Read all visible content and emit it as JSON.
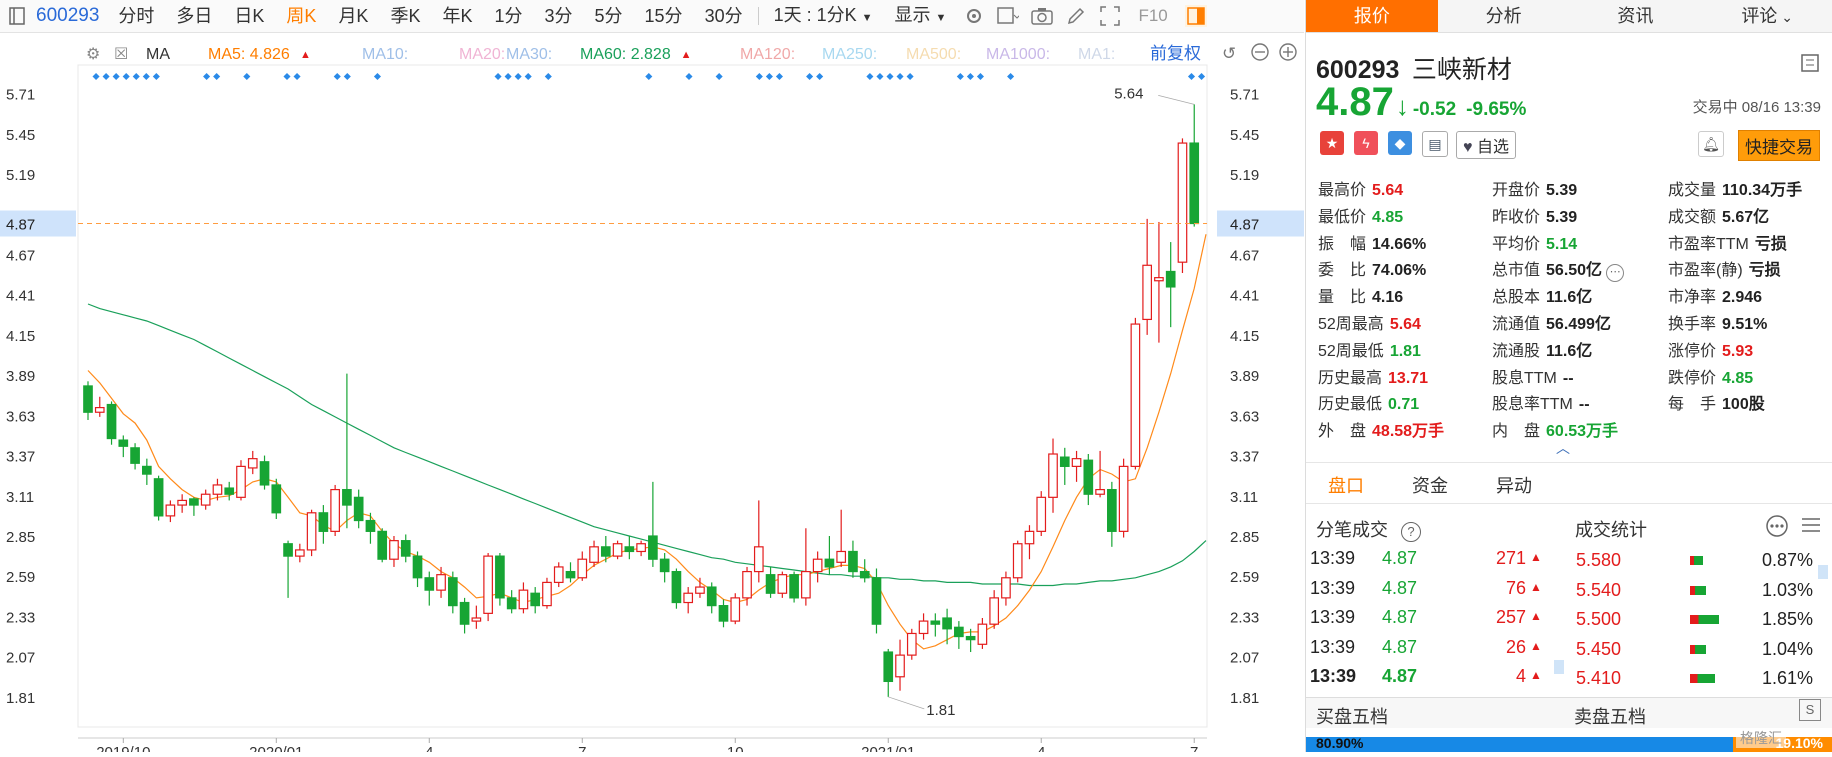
{
  "toolbar": {
    "code": "600293",
    "periods": [
      "分时",
      "多日",
      "日K",
      "周K",
      "月K",
      "季K",
      "年K",
      "1分",
      "3分",
      "5分",
      "15分",
      "30分"
    ],
    "active_period": "周K",
    "interval_select": "1天 : 1分K",
    "display_label": "显示",
    "f10_label": "F10"
  },
  "ma_bar": {
    "ma_label": "MA",
    "items": [
      {
        "text": "MA5: 4.826",
        "color": "#ff7e00",
        "arrow": "up"
      },
      {
        "text": "MA10:",
        "color": "#9fbfe8",
        "arrow": ""
      },
      {
        "text": "MA20:",
        "color": "#f0b4d4",
        "arrow": ""
      },
      {
        "text": "MA30:",
        "color": "#9fbfe8",
        "arrow": ""
      },
      {
        "text": "MA60: 2.828",
        "color": "#1aa05a",
        "arrow": "up"
      },
      {
        "text": "MA120:",
        "color": "#f0a8a8",
        "arrow": ""
      },
      {
        "text": "MA250:",
        "color": "#a8d8f0",
        "arrow": ""
      },
      {
        "text": "MA500:",
        "color": "#f5dcb0",
        "arrow": ""
      },
      {
        "text": "MA1000:",
        "color": "#c9b8e8",
        "arrow": ""
      },
      {
        "text": "MA1:",
        "color": "#cfd8e8",
        "arrow": ""
      }
    ],
    "adjust_label": "前复权"
  },
  "chart_data": {
    "type": "candlestick",
    "y_ticks": [
      "5.71",
      "5.45",
      "5.19",
      "4.67",
      "4.41",
      "4.15",
      "3.89",
      "3.63",
      "3.37",
      "3.11",
      "2.85",
      "2.59",
      "2.33",
      "2.07",
      "1.81"
    ],
    "x_ticks": [
      "2019/10",
      "2020/01",
      "4",
      "7",
      "10",
      "2021/01",
      "4",
      "7"
    ],
    "ylim": [
      1.68,
      5.83
    ],
    "current_price": "4.87",
    "max_label": "5.64",
    "min_label": "1.81",
    "candles": [
      [
        3.82,
        3.65,
        3.85,
        3.6
      ],
      [
        3.65,
        3.68,
        3.75,
        3.62
      ],
      [
        3.7,
        3.48,
        3.72,
        3.44
      ],
      [
        3.47,
        3.43,
        3.5,
        3.36
      ],
      [
        3.42,
        3.32,
        3.45,
        3.28
      ],
      [
        3.3,
        3.25,
        3.35,
        3.18
      ],
      [
        3.22,
        2.98,
        3.24,
        2.95
      ],
      [
        2.98,
        3.05,
        3.08,
        2.94
      ],
      [
        3.05,
        3.08,
        3.12,
        3.0
      ],
      [
        3.09,
        3.05,
        3.1,
        2.98
      ],
      [
        3.05,
        3.12,
        3.15,
        3.02
      ],
      [
        3.12,
        3.18,
        3.22,
        3.08
      ],
      [
        3.16,
        3.12,
        3.2,
        3.08
      ],
      [
        3.1,
        3.3,
        3.34,
        3.08
      ],
      [
        3.29,
        3.35,
        3.4,
        3.25
      ],
      [
        3.33,
        3.18,
        3.37,
        3.15
      ],
      [
        3.18,
        3.0,
        3.22,
        2.96
      ],
      [
        2.8,
        2.72,
        2.82,
        2.45
      ],
      [
        2.72,
        2.76,
        2.8,
        2.68
      ],
      [
        2.76,
        3.0,
        3.02,
        2.72
      ],
      [
        3.0,
        2.88,
        3.05,
        2.8
      ],
      [
        2.88,
        3.15,
        3.18,
        2.85
      ],
      [
        3.15,
        3.05,
        3.9,
        2.9
      ],
      [
        3.1,
        2.95,
        3.15,
        2.9
      ],
      [
        2.95,
        2.88,
        3.0,
        2.8
      ],
      [
        2.88,
        2.7,
        2.9,
        2.68
      ],
      [
        2.7,
        2.82,
        2.85,
        2.65
      ],
      [
        2.82,
        2.72,
        2.86,
        2.68
      ],
      [
        2.72,
        2.58,
        2.75,
        2.52
      ],
      [
        2.58,
        2.5,
        2.62,
        2.4
      ],
      [
        2.5,
        2.6,
        2.65,
        2.45
      ],
      [
        2.58,
        2.4,
        2.62,
        2.35
      ],
      [
        2.42,
        2.28,
        2.45,
        2.22
      ],
      [
        2.3,
        2.32,
        2.4,
        2.25
      ],
      [
        2.35,
        2.72,
        2.74,
        2.3
      ],
      [
        2.72,
        2.45,
        2.74,
        2.4
      ],
      [
        2.45,
        2.38,
        2.5,
        2.35
      ],
      [
        2.38,
        2.5,
        2.55,
        2.35
      ],
      [
        2.48,
        2.4,
        2.52,
        2.35
      ],
      [
        2.4,
        2.55,
        2.58,
        2.38
      ],
      [
        2.55,
        2.65,
        2.68,
        2.52
      ],
      [
        2.62,
        2.58,
        2.68,
        2.55
      ],
      [
        2.58,
        2.7,
        2.75,
        2.56
      ],
      [
        2.68,
        2.78,
        2.82,
        2.65
      ],
      [
        2.78,
        2.72,
        2.85,
        2.68
      ],
      [
        2.72,
        2.8,
        2.82,
        2.7
      ],
      [
        2.78,
        2.75,
        2.85,
        2.7
      ],
      [
        2.75,
        2.8,
        2.82,
        2.72
      ],
      [
        2.85,
        2.7,
        3.2,
        2.65
      ],
      [
        2.7,
        2.62,
        2.74,
        2.55
      ],
      [
        2.62,
        2.42,
        2.64,
        2.38
      ],
      [
        2.42,
        2.48,
        2.52,
        2.35
      ],
      [
        2.48,
        2.52,
        2.58,
        2.45
      ],
      [
        2.52,
        2.4,
        2.55,
        2.35
      ],
      [
        2.4,
        2.3,
        2.44,
        2.26
      ],
      [
        2.3,
        2.45,
        2.48,
        2.28
      ],
      [
        2.45,
        2.62,
        2.65,
        2.4
      ],
      [
        2.62,
        2.78,
        3.08,
        2.55
      ],
      [
        2.6,
        2.48,
        2.65,
        2.45
      ],
      [
        2.48,
        2.6,
        2.62,
        2.45
      ],
      [
        2.6,
        2.45,
        2.62,
        2.42
      ],
      [
        2.45,
        2.62,
        2.9,
        2.4
      ],
      [
        2.62,
        2.7,
        2.75,
        2.55
      ],
      [
        2.7,
        2.65,
        2.85,
        2.6
      ],
      [
        2.68,
        2.75,
        3.02,
        2.65
      ],
      [
        2.75,
        2.62,
        2.82,
        2.58
      ],
      [
        2.62,
        2.58,
        2.7,
        2.55
      ],
      [
        2.58,
        2.28,
        2.64,
        2.22
      ],
      [
        2.1,
        1.91,
        2.12,
        1.81
      ],
      [
        1.94,
        2.08,
        2.18,
        1.85
      ],
      [
        2.08,
        2.22,
        2.25,
        2.05
      ],
      [
        2.22,
        2.3,
        2.35,
        2.18
      ],
      [
        2.3,
        2.28,
        2.35,
        2.2
      ],
      [
        2.32,
        2.25,
        2.38,
        2.15
      ],
      [
        2.26,
        2.2,
        2.3,
        2.12
      ],
      [
        2.2,
        2.18,
        2.25,
        2.1
      ],
      [
        2.15,
        2.28,
        2.32,
        2.12
      ],
      [
        2.28,
        2.45,
        2.5,
        2.25
      ],
      [
        2.45,
        2.58,
        2.62,
        2.4
      ],
      [
        2.58,
        2.8,
        2.82,
        2.55
      ],
      [
        2.8,
        2.88,
        2.92,
        2.7
      ],
      [
        2.88,
        3.1,
        3.14,
        2.85
      ],
      [
        3.1,
        3.38,
        3.48,
        3.0
      ],
      [
        3.36,
        3.3,
        3.42,
        3.18
      ],
      [
        3.3,
        3.35,
        3.4,
        3.2
      ],
      [
        3.34,
        3.12,
        3.38,
        3.05
      ],
      [
        3.12,
        3.15,
        3.4,
        3.1
      ],
      [
        3.15,
        2.88,
        3.2,
        2.78
      ],
      [
        2.88,
        3.3,
        3.35,
        2.84
      ],
      [
        3.3,
        4.22,
        4.26,
        3.28
      ],
      [
        4.25,
        4.6,
        4.9,
        4.15
      ],
      [
        4.5,
        4.52,
        4.88,
        4.1
      ],
      [
        4.56,
        4.46,
        4.75,
        4.2
      ],
      [
        4.62,
        5.39,
        5.42,
        4.55
      ],
      [
        5.39,
        4.87,
        5.64,
        4.85
      ]
    ],
    "ma5": [
      3.92,
      3.84,
      3.74,
      3.64,
      3.58,
      3.47,
      3.3,
      3.22,
      3.15,
      3.1,
      3.08,
      3.1,
      3.11,
      3.15,
      3.2,
      3.22,
      3.2,
      3.1,
      3.0,
      2.98,
      2.92,
      2.88,
      2.95,
      3.0,
      2.98,
      2.88,
      2.8,
      2.75,
      2.72,
      2.68,
      2.62,
      2.58,
      2.52,
      2.45,
      2.46,
      2.48,
      2.45,
      2.42,
      2.44,
      2.46,
      2.48,
      2.53,
      2.6,
      2.66,
      2.7,
      2.74,
      2.76,
      2.77,
      2.78,
      2.76,
      2.7,
      2.62,
      2.55,
      2.5,
      2.44,
      2.42,
      2.44,
      2.5,
      2.55,
      2.58,
      2.6,
      2.6,
      2.62,
      2.64,
      2.66,
      2.66,
      2.64,
      2.55,
      2.4,
      2.28,
      2.18,
      2.12,
      2.14,
      2.18,
      2.22,
      2.23,
      2.23,
      2.27,
      2.32,
      2.4,
      2.5,
      2.62,
      2.78,
      2.95,
      3.1,
      3.22,
      3.28,
      3.25,
      3.2,
      3.22,
      3.42,
      3.65,
      3.9,
      4.18,
      4.45,
      4.8
    ],
    "ma60": [
      4.35,
      4.32,
      4.3,
      4.28,
      4.26,
      4.24,
      4.21,
      4.18,
      4.15,
      4.12,
      4.08,
      4.04,
      4.0,
      3.96,
      3.92,
      3.88,
      3.84,
      3.8,
      3.75,
      3.7,
      3.66,
      3.62,
      3.58,
      3.54,
      3.5,
      3.46,
      3.42,
      3.39,
      3.36,
      3.33,
      3.3,
      3.27,
      3.24,
      3.21,
      3.18,
      3.15,
      3.12,
      3.09,
      3.06,
      3.03,
      3.0,
      2.97,
      2.94,
      2.91,
      2.89,
      2.87,
      2.85,
      2.83,
      2.81,
      2.79,
      2.77,
      2.75,
      2.73,
      2.71,
      2.7,
      2.68,
      2.67,
      2.66,
      2.65,
      2.64,
      2.63,
      2.62,
      2.61,
      2.6,
      2.6,
      2.59,
      2.59,
      2.58,
      2.58,
      2.57,
      2.57,
      2.56,
      2.56,
      2.55,
      2.55,
      2.55,
      2.54,
      2.54,
      2.54,
      2.54,
      2.53,
      2.53,
      2.53,
      2.54,
      2.54,
      2.55,
      2.56,
      2.56,
      2.57,
      2.58,
      2.6,
      2.62,
      2.65,
      2.69,
      2.75,
      2.82
    ]
  },
  "signal_dots": [
    1,
    2,
    3,
    4,
    5,
    6,
    7,
    12,
    13,
    16,
    20,
    21,
    25,
    26,
    29,
    41,
    42,
    43,
    44,
    46,
    56,
    60,
    63,
    67,
    68,
    69,
    72,
    73,
    78,
    79,
    80,
    81,
    82,
    87,
    88,
    89,
    92,
    110,
    111,
    113,
    114,
    115
  ],
  "quote": {
    "code": "600293",
    "name": "三峡新材",
    "price": "4.87",
    "change": "-0.52",
    "change_pct": "-9.65%",
    "status": "交易中 08/16 13:39",
    "watch_label": "自选",
    "trade_label": "快捷交易",
    "fields": [
      {
        "label": "最高价",
        "value": "5.64",
        "color": "red",
        "col": 0,
        "row": 0
      },
      {
        "label": "最低价",
        "value": "4.85",
        "color": "green",
        "col": 0,
        "row": 1
      },
      {
        "label": "振　幅",
        "value": "14.66%",
        "color": "black",
        "col": 0,
        "row": 2
      },
      {
        "label": "委　比",
        "value": "74.06%",
        "color": "black",
        "col": 0,
        "row": 3
      },
      {
        "label": "量　比",
        "value": "4.16",
        "color": "black",
        "col": 0,
        "row": 4
      },
      {
        "label": "52周最高",
        "value": "5.64",
        "color": "red",
        "col": 0,
        "row": 5
      },
      {
        "label": "52周最低",
        "value": "1.81",
        "color": "green",
        "col": 0,
        "row": 6
      },
      {
        "label": "历史最高",
        "value": "13.71",
        "color": "red",
        "col": 0,
        "row": 7
      },
      {
        "label": "历史最低",
        "value": "0.71",
        "color": "green",
        "col": 0,
        "row": 8
      },
      {
        "label": "外　盘",
        "value": "48.58万手",
        "color": "red",
        "col": 0,
        "row": 9
      },
      {
        "label": "开盘价",
        "value": "5.39",
        "color": "black",
        "col": 1,
        "row": 0
      },
      {
        "label": "昨收价",
        "value": "5.39",
        "color": "black",
        "col": 1,
        "row": 1
      },
      {
        "label": "平均价",
        "value": "5.14",
        "color": "green",
        "col": 1,
        "row": 2
      },
      {
        "label": "总市值",
        "value": "56.50亿",
        "color": "black",
        "col": 1,
        "row": 3
      },
      {
        "label": "总股本",
        "value": "11.6亿",
        "color": "black",
        "col": 1,
        "row": 4
      },
      {
        "label": "流通值",
        "value": "56.499亿",
        "color": "black",
        "col": 1,
        "row": 5
      },
      {
        "label": "流通股",
        "value": "11.6亿",
        "color": "black",
        "col": 1,
        "row": 6
      },
      {
        "label": "股息TTM",
        "value": "--",
        "color": "black",
        "col": 1,
        "row": 7
      },
      {
        "label": "股息率TTM",
        "value": "--",
        "color": "black",
        "col": 1,
        "row": 8
      },
      {
        "label": "内　盘",
        "value": "60.53万手",
        "color": "green",
        "col": 1,
        "row": 9
      },
      {
        "label": "成交量",
        "value": "110.34万手",
        "color": "black",
        "col": 2,
        "row": 0
      },
      {
        "label": "成交额",
        "value": "5.67亿",
        "color": "black",
        "col": 2,
        "row": 1
      },
      {
        "label": "市盈率TTM",
        "value": "亏损",
        "color": "black",
        "col": 2,
        "row": 2
      },
      {
        "label": "市盈率(静)",
        "value": "亏损",
        "color": "black",
        "col": 2,
        "row": 3
      },
      {
        "label": "市净率",
        "value": "2.946",
        "color": "black",
        "col": 2,
        "row": 4
      },
      {
        "label": "换手率",
        "value": "9.51%",
        "color": "black",
        "col": 2,
        "row": 5
      },
      {
        "label": "涨停价",
        "value": "5.93",
        "color": "red",
        "col": 2,
        "row": 6
      },
      {
        "label": "跌停价",
        "value": "4.85",
        "color": "green",
        "col": 2,
        "row": 7
      },
      {
        "label": "每　手",
        "value": "100股",
        "color": "black",
        "col": 2,
        "row": 8
      }
    ]
  },
  "panel_tabs": [
    "报价",
    "分析",
    "资讯",
    "评论"
  ],
  "sub_tabs": [
    "盘口",
    "资金",
    "异动"
  ],
  "ticks_title": "分笔成交",
  "stats_title": "成交统计",
  "ticks": [
    {
      "time": "13:39",
      "price": "4.87",
      "vol": "271"
    },
    {
      "time": "13:39",
      "price": "4.87",
      "vol": "76"
    },
    {
      "time": "13:39",
      "price": "4.87",
      "vol": "257"
    },
    {
      "time": "13:39",
      "price": "4.87",
      "vol": "26"
    },
    {
      "time": "13:39",
      "price": "4.87",
      "vol": "4"
    }
  ],
  "stats": [
    {
      "price": "5.580",
      "pct": "0.87%",
      "bar": 0.3
    },
    {
      "price": "5.540",
      "pct": "1.03%",
      "bar": 0.36
    },
    {
      "price": "5.500",
      "pct": "1.85%",
      "bar": 0.65
    },
    {
      "price": "5.450",
      "pct": "1.04%",
      "bar": 0.36
    },
    {
      "price": "5.410",
      "pct": "1.61%",
      "bar": 0.56
    }
  ],
  "buy5_label": "买盘五档",
  "sell5_label": "卖盘五档",
  "bottom_pct_left": "80.90%",
  "bottom_pct_right": "19.10%",
  "watermark": "格隆汇"
}
